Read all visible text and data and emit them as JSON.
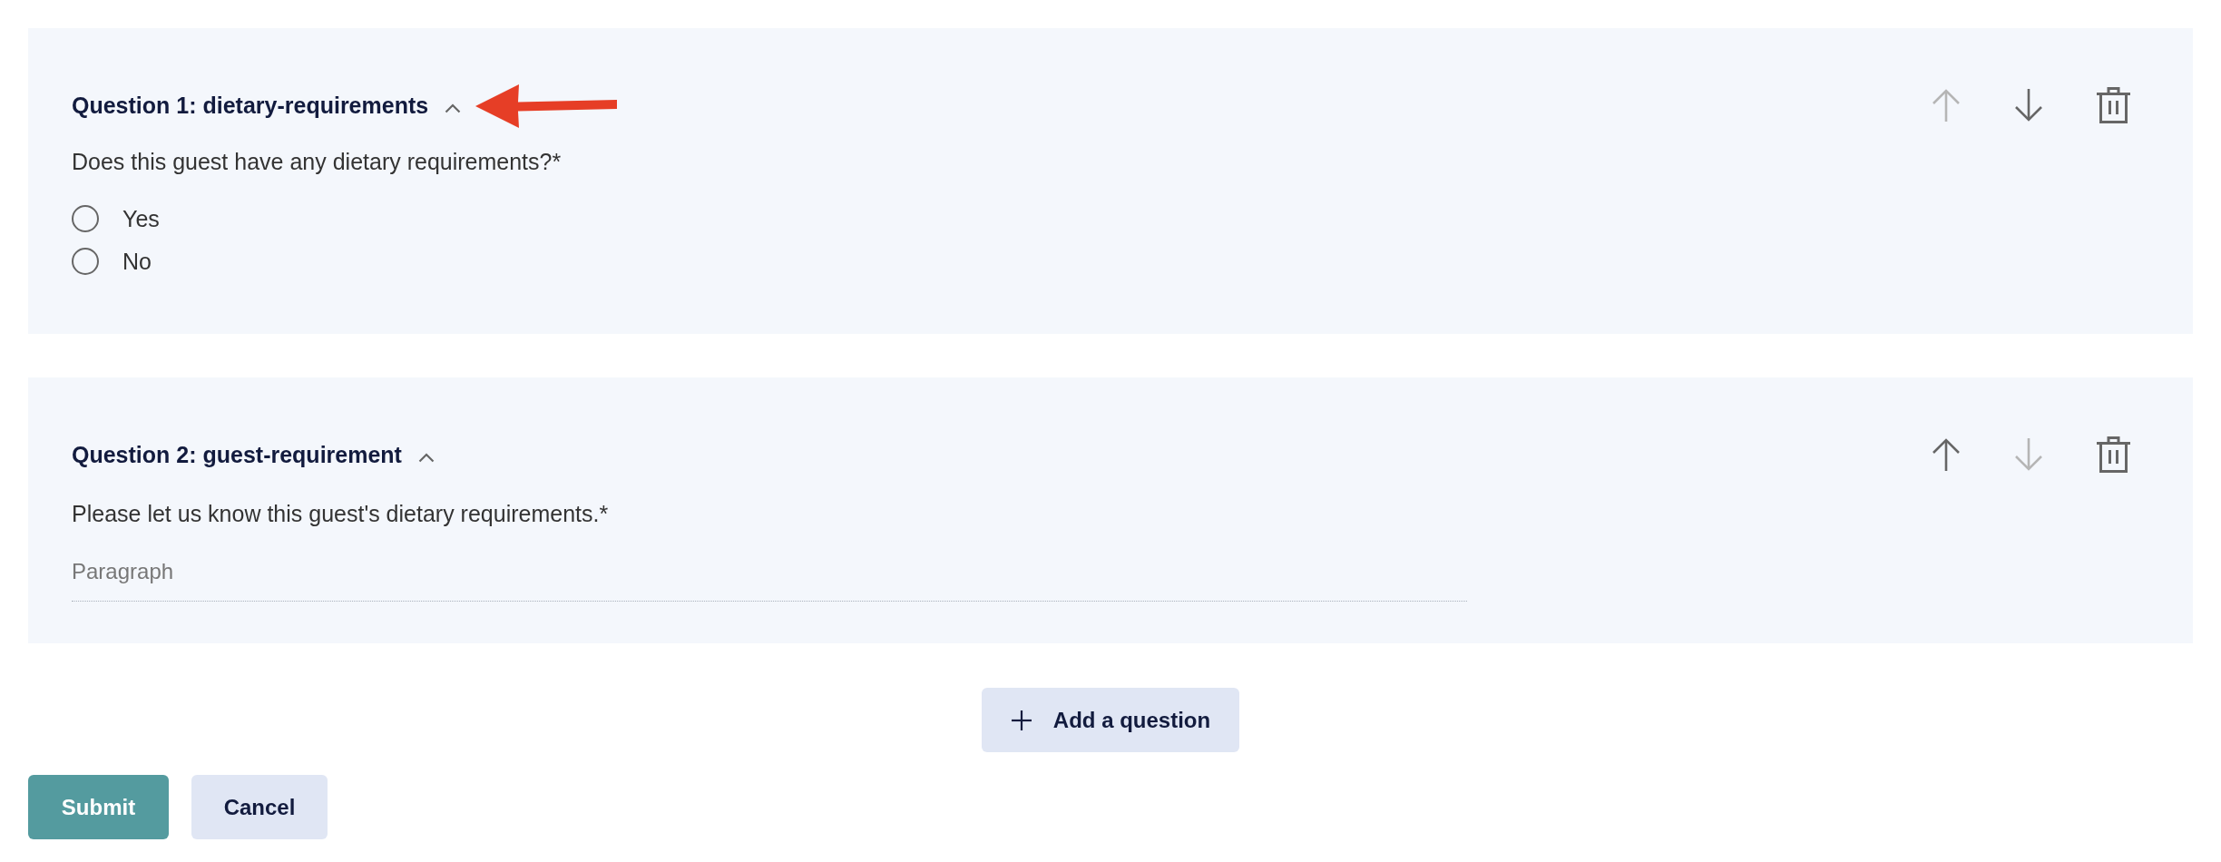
{
  "questions": [
    {
      "title": "Question 1: dietary-requirements",
      "expanded": true,
      "annotated": true,
      "prompt": "Does this guest have any dietary requirements?*",
      "kind": "radio",
      "options": [
        {
          "label": "Yes",
          "selected": false
        },
        {
          "label": "No",
          "selected": false
        }
      ],
      "controls": [
        {
          "kind": "move-up",
          "disabled": true
        },
        {
          "kind": "move-down",
          "disabled": false
        },
        {
          "kind": "delete",
          "disabled": false
        }
      ]
    },
    {
      "title": "Question 2: guest-requirement",
      "expanded": true,
      "annotated": false,
      "prompt": "Please let us know this guest's dietary requirements.*",
      "kind": "paragraph",
      "placeholder": "Paragraph",
      "controls": [
        {
          "kind": "move-up",
          "disabled": false
        },
        {
          "kind": "move-down",
          "disabled": true
        },
        {
          "kind": "delete",
          "disabled": false
        }
      ]
    }
  ],
  "add_button": {
    "label": "Add a question"
  },
  "actions": [
    {
      "label": "Submit",
      "kind": "primary"
    },
    {
      "label": "Cancel",
      "kind": "secondary"
    }
  ]
}
